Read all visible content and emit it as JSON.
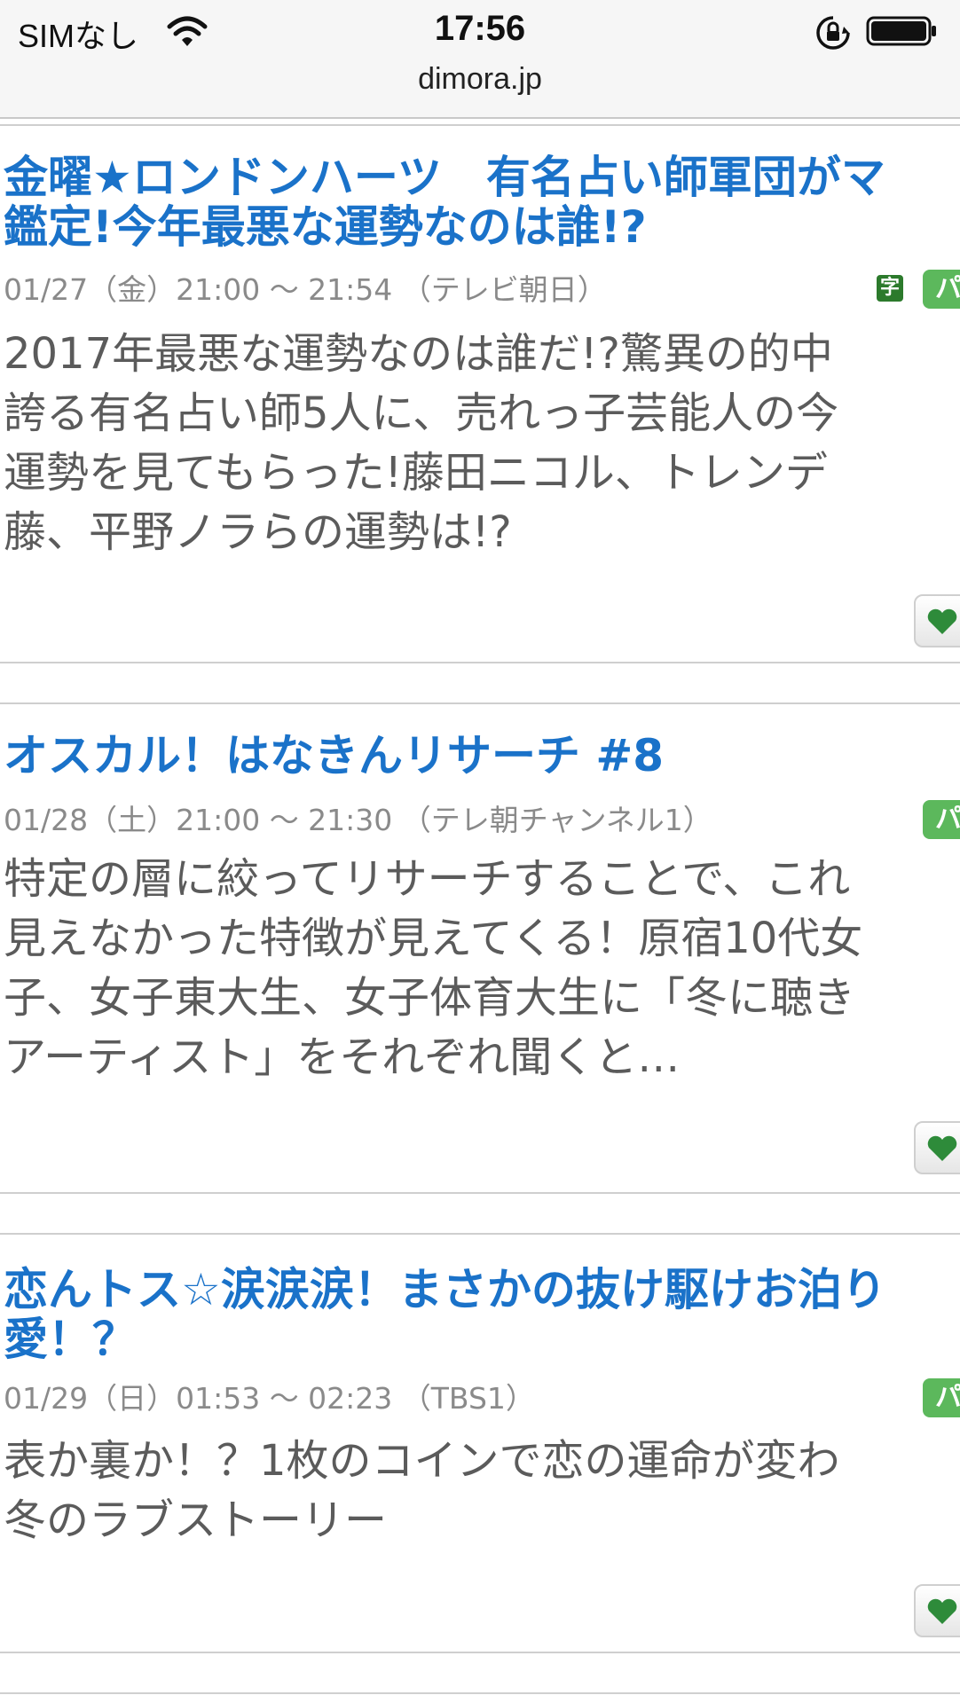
{
  "status_bar": {
    "carrier": "SIMなし",
    "time": "17:56"
  },
  "browser": {
    "url": "dimora.jp"
  },
  "programs": [
    {
      "title_line1": "金曜★ロンドンハーツ　有名占い師軍団がマ",
      "title_line2": "鑑定!今年最悪な運勢なのは誰!?",
      "meta": "01/27（金）21:00 ～ 21:54 （テレビ朝日）",
      "has_subtitle_badge": true,
      "subtitle_badge": "字",
      "desc_lines": [
        "2017年最悪な運勢なのは誰だ!?驚異の的中",
        "誇る有名占い師5人に、売れっ子芸能人の今",
        "運勢を見てもらった!藤田ニコル、トレンデ",
        "藤、平野ノラらの運勢は!?"
      ],
      "status_badge": "パ"
    },
    {
      "title_line1": "オスカル！はなきんリサーチ #8",
      "title_line2": "",
      "meta": "01/28（土）21:00 ～ 21:30 （テレ朝チャンネル1）",
      "has_subtitle_badge": false,
      "subtitle_badge": "",
      "desc_lines": [
        "特定の層に絞ってリサーチすることで、これ",
        "見えなかった特徴が見えてくる！原宿10代女",
        "子、女子東大生、女子体育大生に「冬に聴き",
        "アーティスト」をそれぞれ聞くと…"
      ],
      "status_badge": "パ"
    },
    {
      "title_line1": "恋んトス☆涙涙涙！まさかの抜け駆けお泊り",
      "title_line2": "愛！？",
      "meta": "01/29（日）01:53 ～ 02:23 （TBS1）",
      "has_subtitle_badge": false,
      "subtitle_badge": "",
      "desc_lines": [
        "表か裏か！？1枚のコインで恋の運命が変わ",
        "冬のラブストーリー"
      ],
      "status_badge": "パ"
    }
  ],
  "colors": {
    "title": "#1a72c9",
    "badge_green": "#5cb85c",
    "heart": "#2e8b3a"
  }
}
